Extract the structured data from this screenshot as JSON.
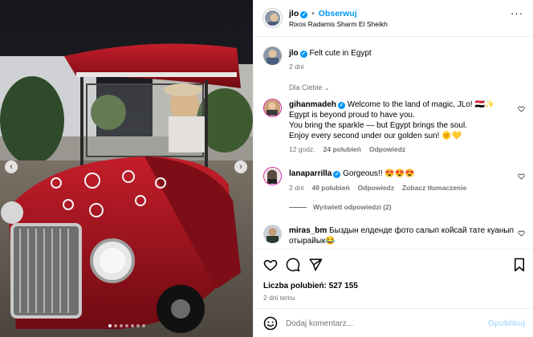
{
  "post": {
    "username": "jlo",
    "follow_label": "Obserwuj",
    "location": "Rixos Radamis Sharm El Sheikh",
    "more_icon": "more-horizontal-icon"
  },
  "caption": {
    "username": "jlo",
    "text": "Felt cute in Egypt",
    "time": "2 dni"
  },
  "comments_filter": "Dla Ciebie",
  "comments": [
    {
      "username": "gihanmadeh",
      "lines": [
        "Welcome to the land of magic, JLo! 🇪🇬✨",
        "Egypt is beyond proud to have you.",
        "You bring the sparkle — but Egypt brings the soul.",
        "Enjoy every second under our golden sun! 🌞💛"
      ],
      "time": "12 godz.",
      "likes": "24 polubień",
      "reply": "Odpowiedz"
    },
    {
      "username": "lanaparrilla",
      "text": "Gorgeous!! 😍😍😍",
      "time": "2 dni",
      "likes": "49 polubień",
      "reply": "Odpowiedz",
      "translate": "Zobacz tłumaczenie",
      "view_replies": "Wyświetl odpowiedzi (2)"
    },
    {
      "username": "miras_bm",
      "text_line1": "Быздын елденде фото салып койсай тате куанып",
      "text_line2": "отырайык😂"
    }
  ],
  "actions": {
    "like_icon": "heart-icon",
    "comment_icon": "comment-icon",
    "share_icon": "share-icon",
    "save_icon": "bookmark-icon"
  },
  "likes_label": "Liczba polubień: 527 155",
  "post_time": "2 dni temu",
  "add_comment": {
    "placeholder": "Dodaj komentarz...",
    "publish_label": "Opublikuj",
    "emoji_icon": "smiley-icon"
  },
  "carousel": {
    "dots": 7,
    "active_index": 0
  },
  "colors": {
    "accent": "#0095f6",
    "car_red": "#a3121c",
    "muted": "#737373"
  }
}
